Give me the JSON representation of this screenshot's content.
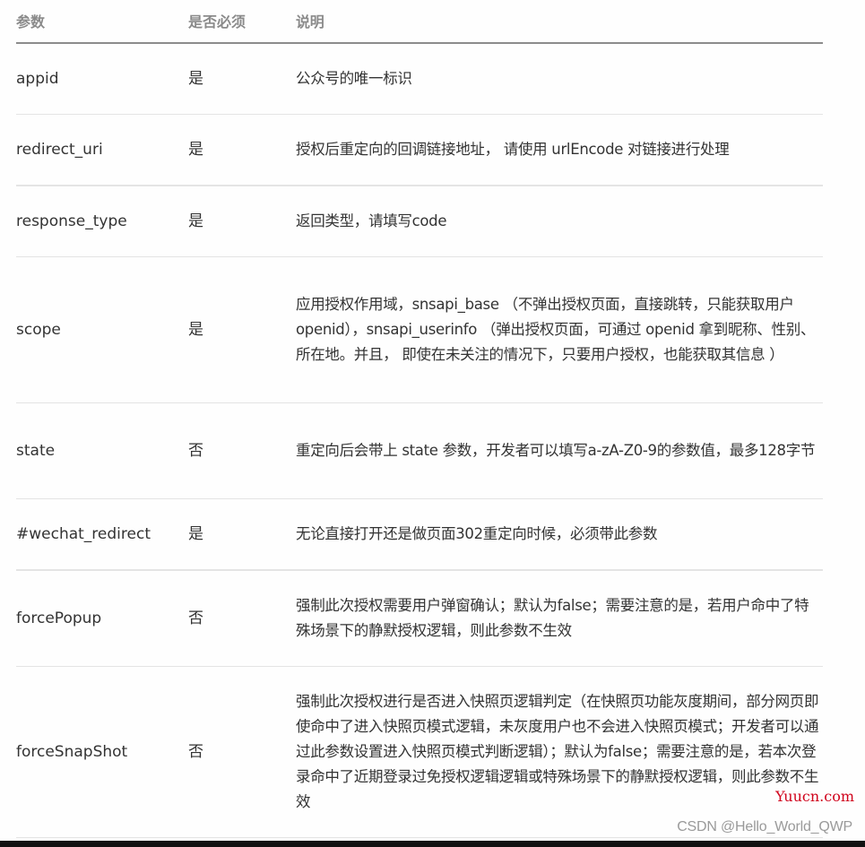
{
  "table": {
    "headers": [
      "参数",
      "是否必须",
      "说明"
    ],
    "rows": [
      {
        "param": "appid",
        "required": "是",
        "desc": "公众号的唯一标识"
      },
      {
        "param": "redirect_uri",
        "required": "是",
        "desc": "授权后重定向的回调链接地址， 请使用 urlEncode 对链接进行处理"
      },
      {
        "param": "response_type",
        "required": "是",
        "desc": "返回类型，请填写code"
      },
      {
        "param": "scope",
        "required": "是",
        "desc": "应用授权作用域，snsapi_base （不弹出授权页面，直接跳转，只能获取用户openid），snsapi_userinfo （弹出授权页面，可通过 openid 拿到昵称、性别、所在地。并且， 即使在未关注的情况下，只要用户授权，也能获取其信息 ）"
      },
      {
        "param": "state",
        "required": "否",
        "desc": "重定向后会带上 state 参数，开发者可以填写a-zA-Z0-9的参数值，最多128字节"
      },
      {
        "param": "#wechat_redirect",
        "required": "是",
        "desc": "无论直接打开还是做页面302重定向时候，必须带此参数"
      },
      {
        "param": "forcePopup",
        "required": "否",
        "desc": "强制此次授权需要用户弹窗确认；默认为false；需要注意的是，若用户命中了特殊场景下的静默授权逻辑，则此参数不生效"
      },
      {
        "param": "forceSnapShot",
        "required": "否",
        "desc": "强制此次授权进行是否进入快照页逻辑判定（在快照页功能灰度期间，部分网页即使命中了进入快照页模式逻辑，未灰度用户也不会进入快照页模式；开发者可以通过此参数设置进入快照页模式判断逻辑）；默认为false；需要注意的是，若本次登录命中了近期登录过免授权逻辑逻辑或特殊场景下的静默授权逻辑，则此参数不生效"
      }
    ]
  },
  "watermarks": {
    "site": "Yuucn.com",
    "author": "CSDN @Hello_World_QWP"
  },
  "colors": {
    "header_text": "#8a8a8a",
    "body_text": "#333333",
    "header_rule": "#8c8c8c",
    "row_rule": "#e4e4e4",
    "site_watermark": "#d0021b"
  }
}
